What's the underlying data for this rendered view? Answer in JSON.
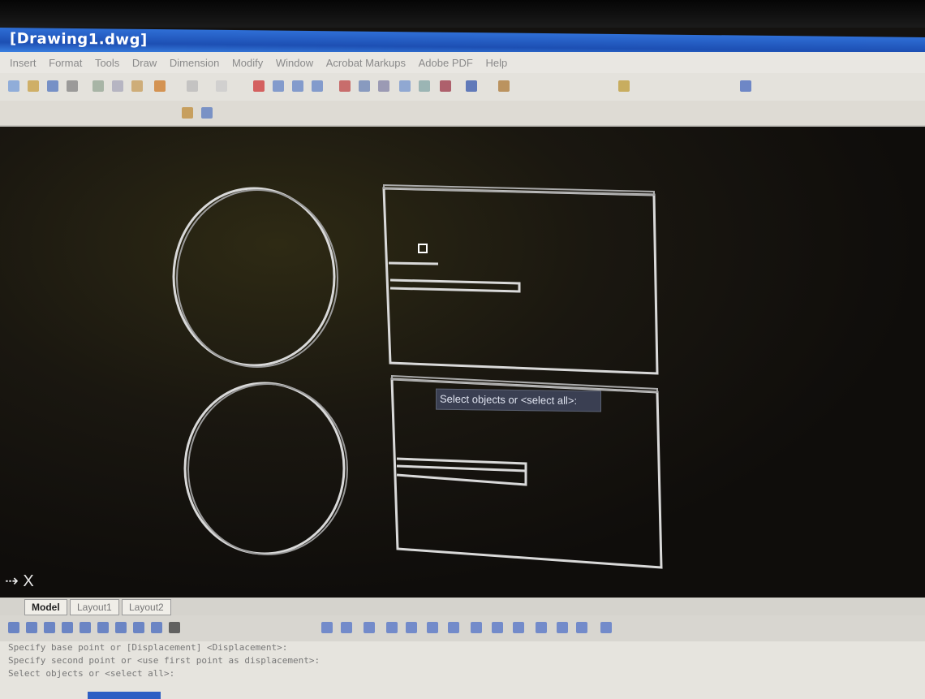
{
  "window": {
    "title": "[Drawing1.dwg]"
  },
  "menu": [
    "Insert",
    "Format",
    "Tools",
    "Draw",
    "Dimension",
    "Modify",
    "Window",
    "Acrobat Markups",
    "Adobe PDF",
    "Help"
  ],
  "canvas": {
    "prompt": "Select objects or <select all>:"
  },
  "axis_marker": "⇢ X",
  "layout_tabs": [
    "Model",
    "Layout1",
    "Layout2"
  ],
  "command_history": [
    "Specify base point or [Displacement] <Displacement>:",
    "Specify second point or <use first point as displacement>:",
    "Select objects or <select all>:"
  ],
  "colors": {
    "titlebar": "#1d4fb3",
    "canvas": "#141210",
    "geometry": "#d9d9d9",
    "tooltip": "#3a3f52"
  }
}
